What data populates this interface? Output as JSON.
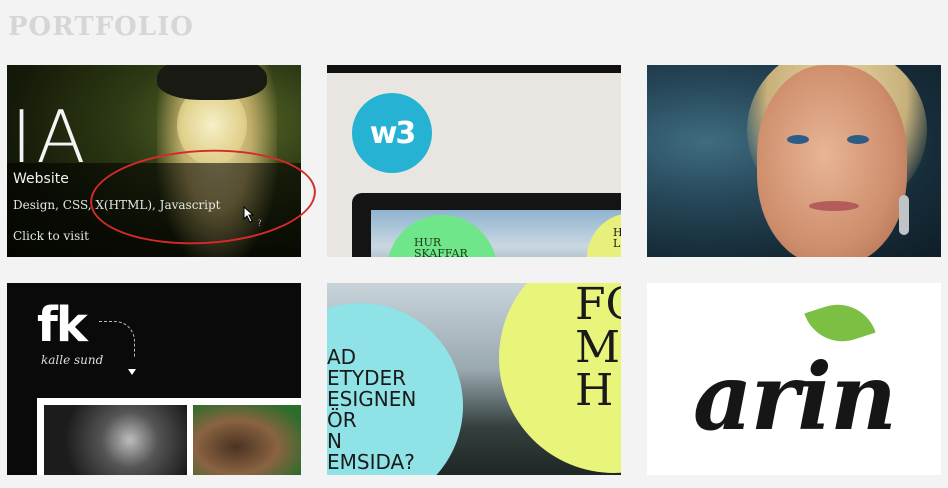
{
  "page": {
    "heading": "PORTFOLIO"
  },
  "tiles": [
    {
      "overlay_letters": "IA",
      "overlay": {
        "title": "Website",
        "tags": "Design, CSS, X(HTML), Javascript",
        "link": "Click to visit"
      }
    },
    {
      "logo_text": "w3",
      "green_text": "HUR\nSKAFFAR",
      "yellow_text": "H\nL"
    },
    {},
    {
      "logo_text": "fk",
      "signature": "kalle sund"
    },
    {
      "cyan_text": "AD\nETYDER\nESIGNEN\nÖR\nN\nEMSIDA?",
      "lime_text": "FÖ\nM\nH"
    },
    {
      "logo_text": "arin"
    }
  ],
  "colors": {
    "annotation": "#d42a2a",
    "logo_blue": "#26b3d3",
    "leaf_green": "#7bc043"
  }
}
